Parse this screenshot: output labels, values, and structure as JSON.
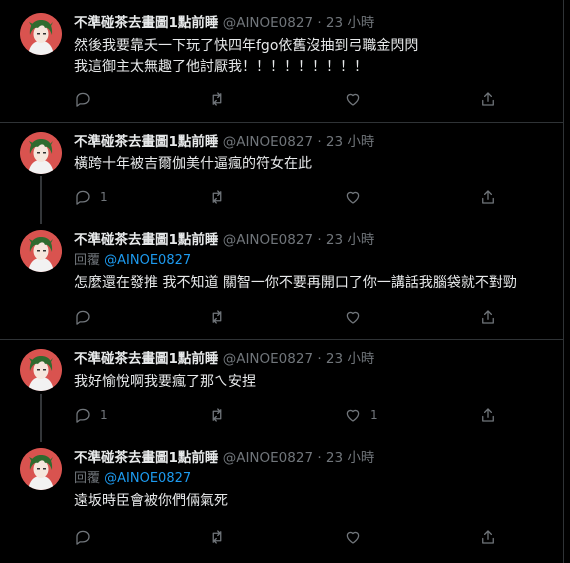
{
  "author": {
    "name": "不準碰茶去畫圖1點前睡",
    "handle": "@AINOE0827",
    "time": "23 小時",
    "separator": " · "
  },
  "reply_prefix": "回覆",
  "tweets": [
    {
      "lines": [
        "然後我要靠夭一下玩了快四年fgo依舊沒抽到弓職金閃閃",
        "我這御主太無趣了他討厭我！！！！！！！！！"
      ],
      "reply_to": null,
      "counts": {
        "reply": "",
        "retweet": "",
        "like": ""
      }
    },
    {
      "lines": [
        "橫跨十年被吉爾伽美什逼瘋的符女在此"
      ],
      "reply_to": null,
      "counts": {
        "reply": "1",
        "retweet": "",
        "like": ""
      }
    },
    {
      "lines": [
        "怎麼還在發推 我不知道 關智一你不要再開口了你一講話我腦袋就不對勁"
      ],
      "reply_to": "@AINOE0827",
      "counts": {
        "reply": "",
        "retweet": "",
        "like": ""
      }
    },
    {
      "lines": [
        "我好愉悅啊我要瘋了那ㄟ安捏"
      ],
      "reply_to": null,
      "counts": {
        "reply": "1",
        "retweet": "",
        "like": "1"
      }
    },
    {
      "lines": [
        "遠坂時臣會被你們倆氣死"
      ],
      "reply_to": "@AINOE0827",
      "counts": {
        "reply": "",
        "retweet": "",
        "like": ""
      }
    }
  ],
  "icons": {
    "reply": "reply-icon",
    "retweet": "retweet-icon",
    "like": "heart-icon",
    "share": "share-icon"
  },
  "colors": {
    "background": "#000000",
    "text": "#e7e9ea",
    "muted": "#71767b",
    "link": "#1d9bf0",
    "divider": "#2f3336",
    "avatar_bg": "#d9534f"
  }
}
